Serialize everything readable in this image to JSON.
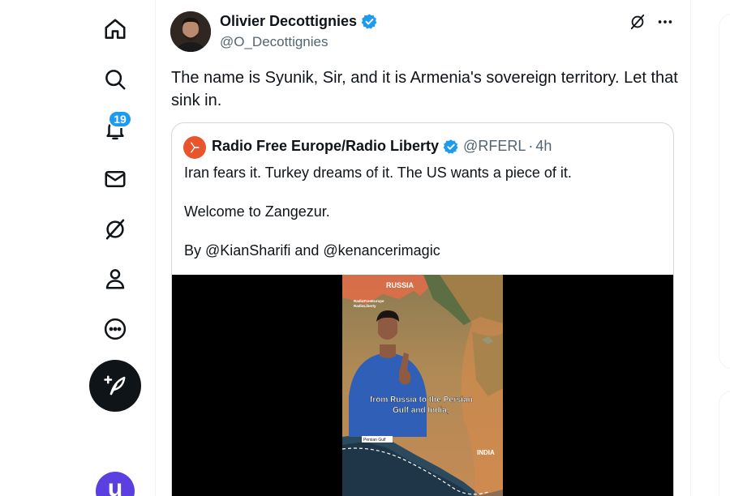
{
  "nav": {
    "items": [
      {
        "name": "home",
        "icon": "home-icon"
      },
      {
        "name": "explore",
        "icon": "search-icon"
      },
      {
        "name": "notifications",
        "icon": "bell-icon"
      },
      {
        "name": "messages",
        "icon": "mail-icon"
      },
      {
        "name": "grok",
        "icon": "grok-icon"
      },
      {
        "name": "profile",
        "icon": "person-icon"
      },
      {
        "name": "more",
        "icon": "more-circle-icon"
      }
    ],
    "notifications_badge": "19",
    "post_button_icon": "feather-plus-icon",
    "account_initial": "u"
  },
  "tweet": {
    "author_name": "Olivier Decottignies",
    "author_handle": "@O_Decottignies",
    "verified": true,
    "text": "The name is Syunik, Sir, and it is Armenia's sovereign territory. Let that sink in.",
    "quote": {
      "author_name": "Radio Free Europe/Radio Liberty",
      "author_handle": "@RFERL",
      "separator": "·",
      "time": "4h",
      "verified": true,
      "lines": [
        "Iran fears it. Turkey dreams of it. The US wants a piece of it.",
        "Welcome to Zangezur.",
        "By @KianSharifi and @kenancerimagic"
      ],
      "media": {
        "map_label_top": "RUSSIA",
        "map_label_bottom": "INDIA",
        "map_label_gulf": "Persian Gulf",
        "caption_line1": "from Russia to the Persian",
        "caption_line2": "Gulf and India,",
        "logo_line1": "RadioFreeEurope",
        "logo_line2": "RadioLiberty"
      }
    }
  },
  "colors": {
    "accent": "#1d9bf0",
    "rferl_orange": "#e8542b",
    "text_primary": "#0f1419",
    "text_secondary": "#536471"
  }
}
